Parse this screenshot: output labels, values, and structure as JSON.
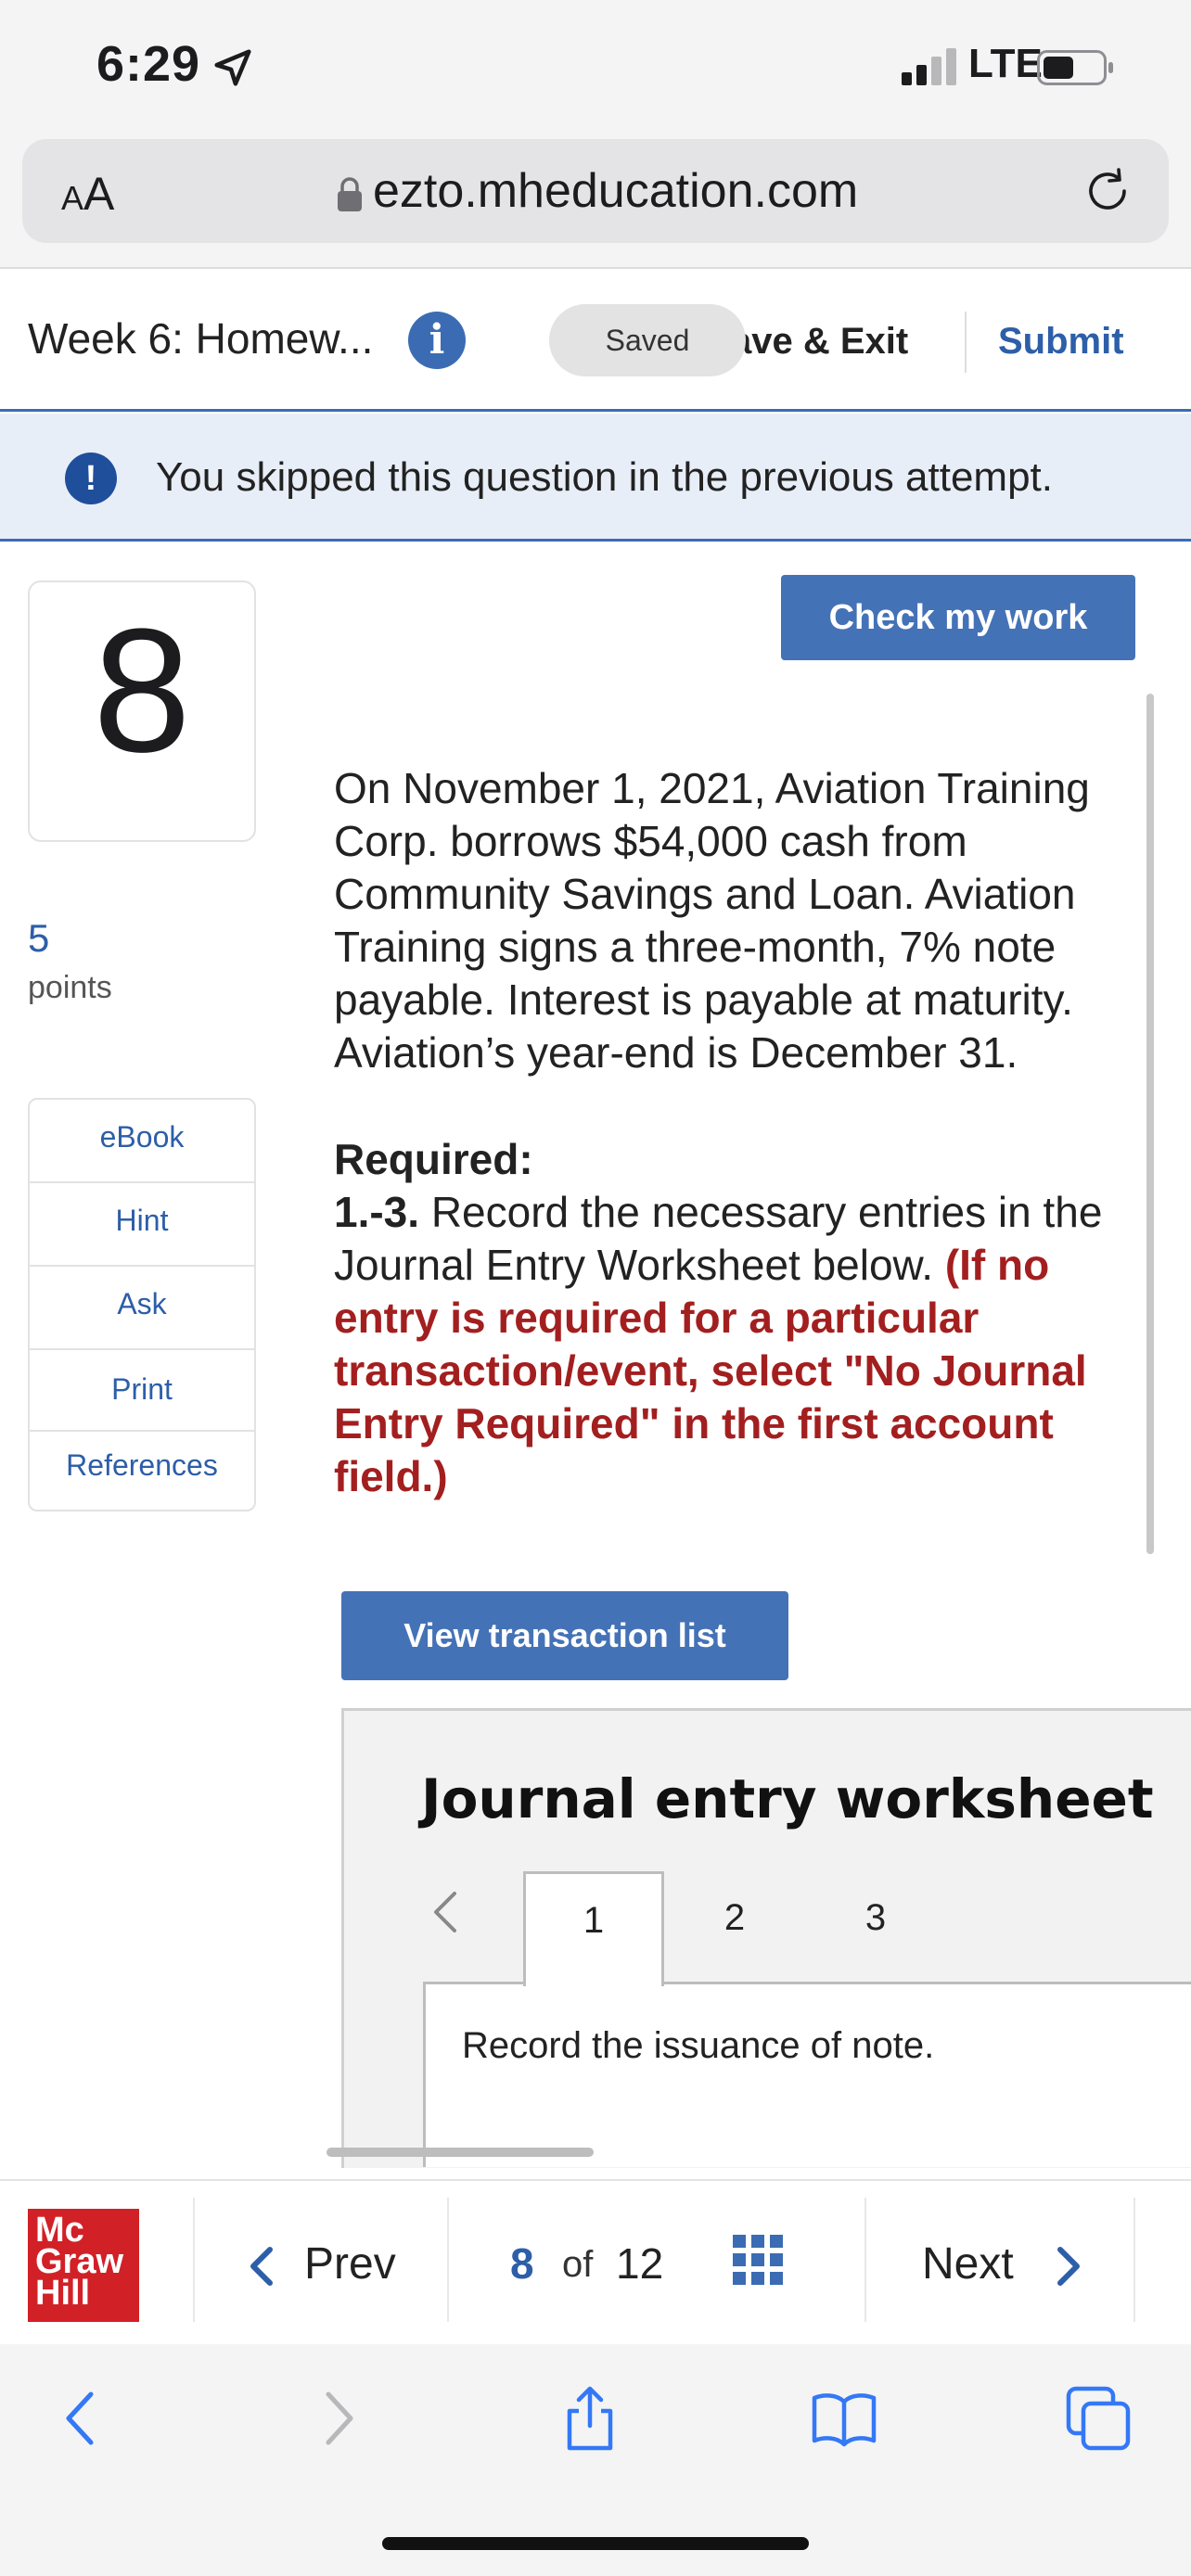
{
  "status_bar": {
    "time": "6:29",
    "network": "LTE",
    "icons": [
      "location-arrow-icon",
      "signal-icon",
      "battery-icon"
    ]
  },
  "browser": {
    "text_size_label_small": "A",
    "text_size_label_large": "A",
    "url": "ezto.mheducation.com",
    "icons": [
      "lock-icon",
      "reload-icon"
    ]
  },
  "header": {
    "assignment_title": "Week 6: Homew...",
    "saved_badge": "Saved",
    "save_exit_label": "ave & Exit",
    "submit_label": "Submit",
    "accent_color": "#3b6cb3"
  },
  "banner": {
    "text": "You skipped this question in the previous attempt."
  },
  "question": {
    "number": "8",
    "points_value": "5",
    "points_label": "points",
    "check_label": "Check my work",
    "paragraph": "On November 1, 2021, Aviation Training Corp. borrows $54,000 cash from Community Savings and Loan. Aviation Training signs a three-month, 7% note payable. Interest is payable at maturity. Aviation’s year-end is December 31.",
    "required_heading": "Required:",
    "required_number": "1.-3.",
    "required_text": " Record the necessary entries in the Journal Entry Worksheet below. ",
    "required_note": "(If no entry is required for a particular transaction/event, select \"No Journal Entry Required\" in the first account field.)",
    "note_color": "#a31f1f"
  },
  "sidebar": {
    "items": [
      {
        "label": "eBook"
      },
      {
        "label": "Hint"
      },
      {
        "label": "Ask"
      },
      {
        "label": "Print"
      },
      {
        "label": "References"
      }
    ]
  },
  "worksheet": {
    "view_list_label": "View transaction list",
    "title": "Journal entry worksheet",
    "tabs": [
      "1",
      "2",
      "3"
    ],
    "active_tab": "1",
    "description": "Record the issuance of note."
  },
  "bottom_nav": {
    "logo_lines": [
      "Mc",
      "Graw",
      "Hill"
    ],
    "prev_label": "Prev",
    "current_page": "8",
    "of_label": "of",
    "total_pages": "12",
    "next_label": "Next"
  },
  "toolbar": {
    "icons": [
      "back-icon",
      "forward-icon",
      "share-icon",
      "bookmarks-icon",
      "tabs-icon"
    ]
  }
}
